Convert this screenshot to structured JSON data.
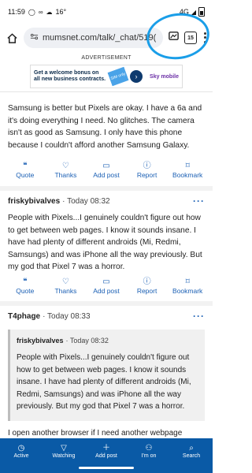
{
  "status_bar": {
    "time": "11:59",
    "temperature": "16°",
    "network": "4G"
  },
  "browser": {
    "url": "mumsnet.com/talk/_chat/519(",
    "tab_count": "15"
  },
  "ad": {
    "label": "ADVERTISEMENT",
    "headline": "Get a welcome bonus on all new business contracts.",
    "sim_label": "SIM only",
    "brand": "Sky mobile"
  },
  "posts": [
    {
      "text": "Samsung is better but Pixels are okay. I have a 6a and it's doing everything I need. No glitches. The camera isn't as good as Samsung. I only have this phone because I couldn't afford another Samsung Galaxy.",
      "actions": [
        "Quote",
        "Thanks",
        "Add post",
        "Report",
        "Bookmark"
      ]
    },
    {
      "username": "friskybivalves",
      "timestamp": "· Today 08:32",
      "text": "People with Pixels...I genuinely couldn't figure out how to get between web pages. I know it sounds insane. I have had plenty of different androids (Mi, Redmi, Samsungs) and was iPhone all the way previously. But my god that Pixel 7 was a horror.",
      "actions": [
        "Quote",
        "Thanks",
        "Add post",
        "Report",
        "Bookmark"
      ]
    },
    {
      "username": "T4phage",
      "timestamp": "· Today 08:33",
      "quote": {
        "username": "friskybivalves",
        "timestamp": "· Today 08:32",
        "text": "People with Pixels...I genuinely couldn't figure out how to get between web pages. I know it sounds insane. I have had plenty of different androids (Mi, Redmi, Samsungs) and was iPhone all the way previously. But my god that Pixel 7 was a horror."
      },
      "text": "I open another browser if I need another webpage"
    }
  ],
  "bottom_nav": [
    "Active",
    "Watching",
    "Add post",
    "I'm on",
    "Search"
  ],
  "colors": {
    "accent": "#1a5fb4",
    "nav_bg": "#0a5aa6",
    "annotation": "#1a9ee8"
  },
  "icons": {
    "actions": [
      "quote-icon",
      "thanks-icon",
      "add-post-icon",
      "report-icon",
      "bookmark-icon"
    ],
    "nav": [
      "clock-icon",
      "filter-icon",
      "plus-icon",
      "people-icon",
      "search-icon"
    ]
  }
}
